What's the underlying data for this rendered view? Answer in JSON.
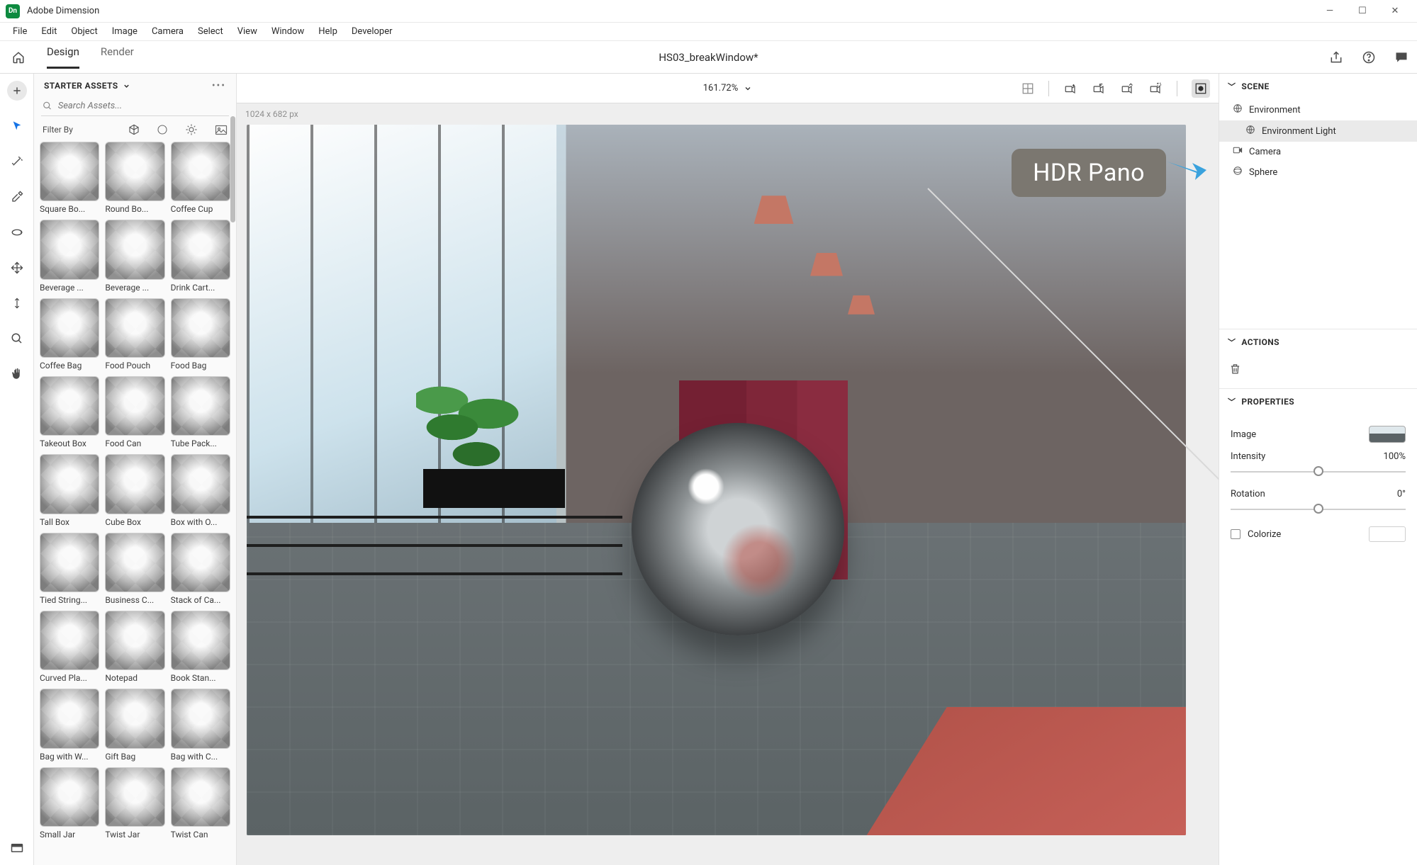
{
  "app": {
    "name": "Adobe Dimension",
    "logo": "Dn"
  },
  "window_controls": {
    "min": "—",
    "max": "☐",
    "close": "✕"
  },
  "menu": [
    "File",
    "Edit",
    "Object",
    "Image",
    "Camera",
    "Select",
    "View",
    "Window",
    "Help",
    "Developer"
  ],
  "header": {
    "tabs": {
      "design": "Design",
      "render": "Render"
    },
    "doc_title": "HS03_breakWindow*"
  },
  "zoom": {
    "value": "161.72%"
  },
  "canvas": {
    "dimensions": "1024 x 682 px"
  },
  "assets": {
    "header": "STARTER ASSETS",
    "search_placeholder": "Search Assets...",
    "filter_label": "Filter By",
    "items": [
      "Square Bo...",
      "Round Bo...",
      "Coffee Cup",
      "Beverage ...",
      "Beverage ...",
      "Drink Cart...",
      "Coffee Bag",
      "Food Pouch",
      "Food Bag",
      "Takeout Box",
      "Food Can",
      "Tube Pack...",
      "Tall Box",
      "Cube Box",
      "Box with O...",
      "Tied String...",
      "Business C...",
      "Stack of Ca...",
      "Curved Pla...",
      "Notepad",
      "Book Stan...",
      "Bag with W...",
      "Gift Bag",
      "Bag with C...",
      "Small Jar",
      "Twist Jar",
      "Twist Can"
    ]
  },
  "scene": {
    "header": "SCENE",
    "items": [
      {
        "label": "Environment",
        "indent": false,
        "selected": false,
        "icon": "globe"
      },
      {
        "label": "Environment Light",
        "indent": true,
        "selected": true,
        "icon": "globe"
      },
      {
        "label": "Camera",
        "indent": false,
        "selected": false,
        "icon": "camera"
      },
      {
        "label": "Sphere",
        "indent": false,
        "selected": false,
        "icon": "sphere"
      }
    ]
  },
  "actions": {
    "header": "ACTIONS"
  },
  "properties": {
    "header": "PROPERTIES",
    "image_label": "Image",
    "intensity_label": "Intensity",
    "intensity_value": "100%",
    "rotation_label": "Rotation",
    "rotation_value": "0°",
    "colorize_label": "Colorize"
  },
  "annotation": {
    "badge": "HDR Pano"
  }
}
